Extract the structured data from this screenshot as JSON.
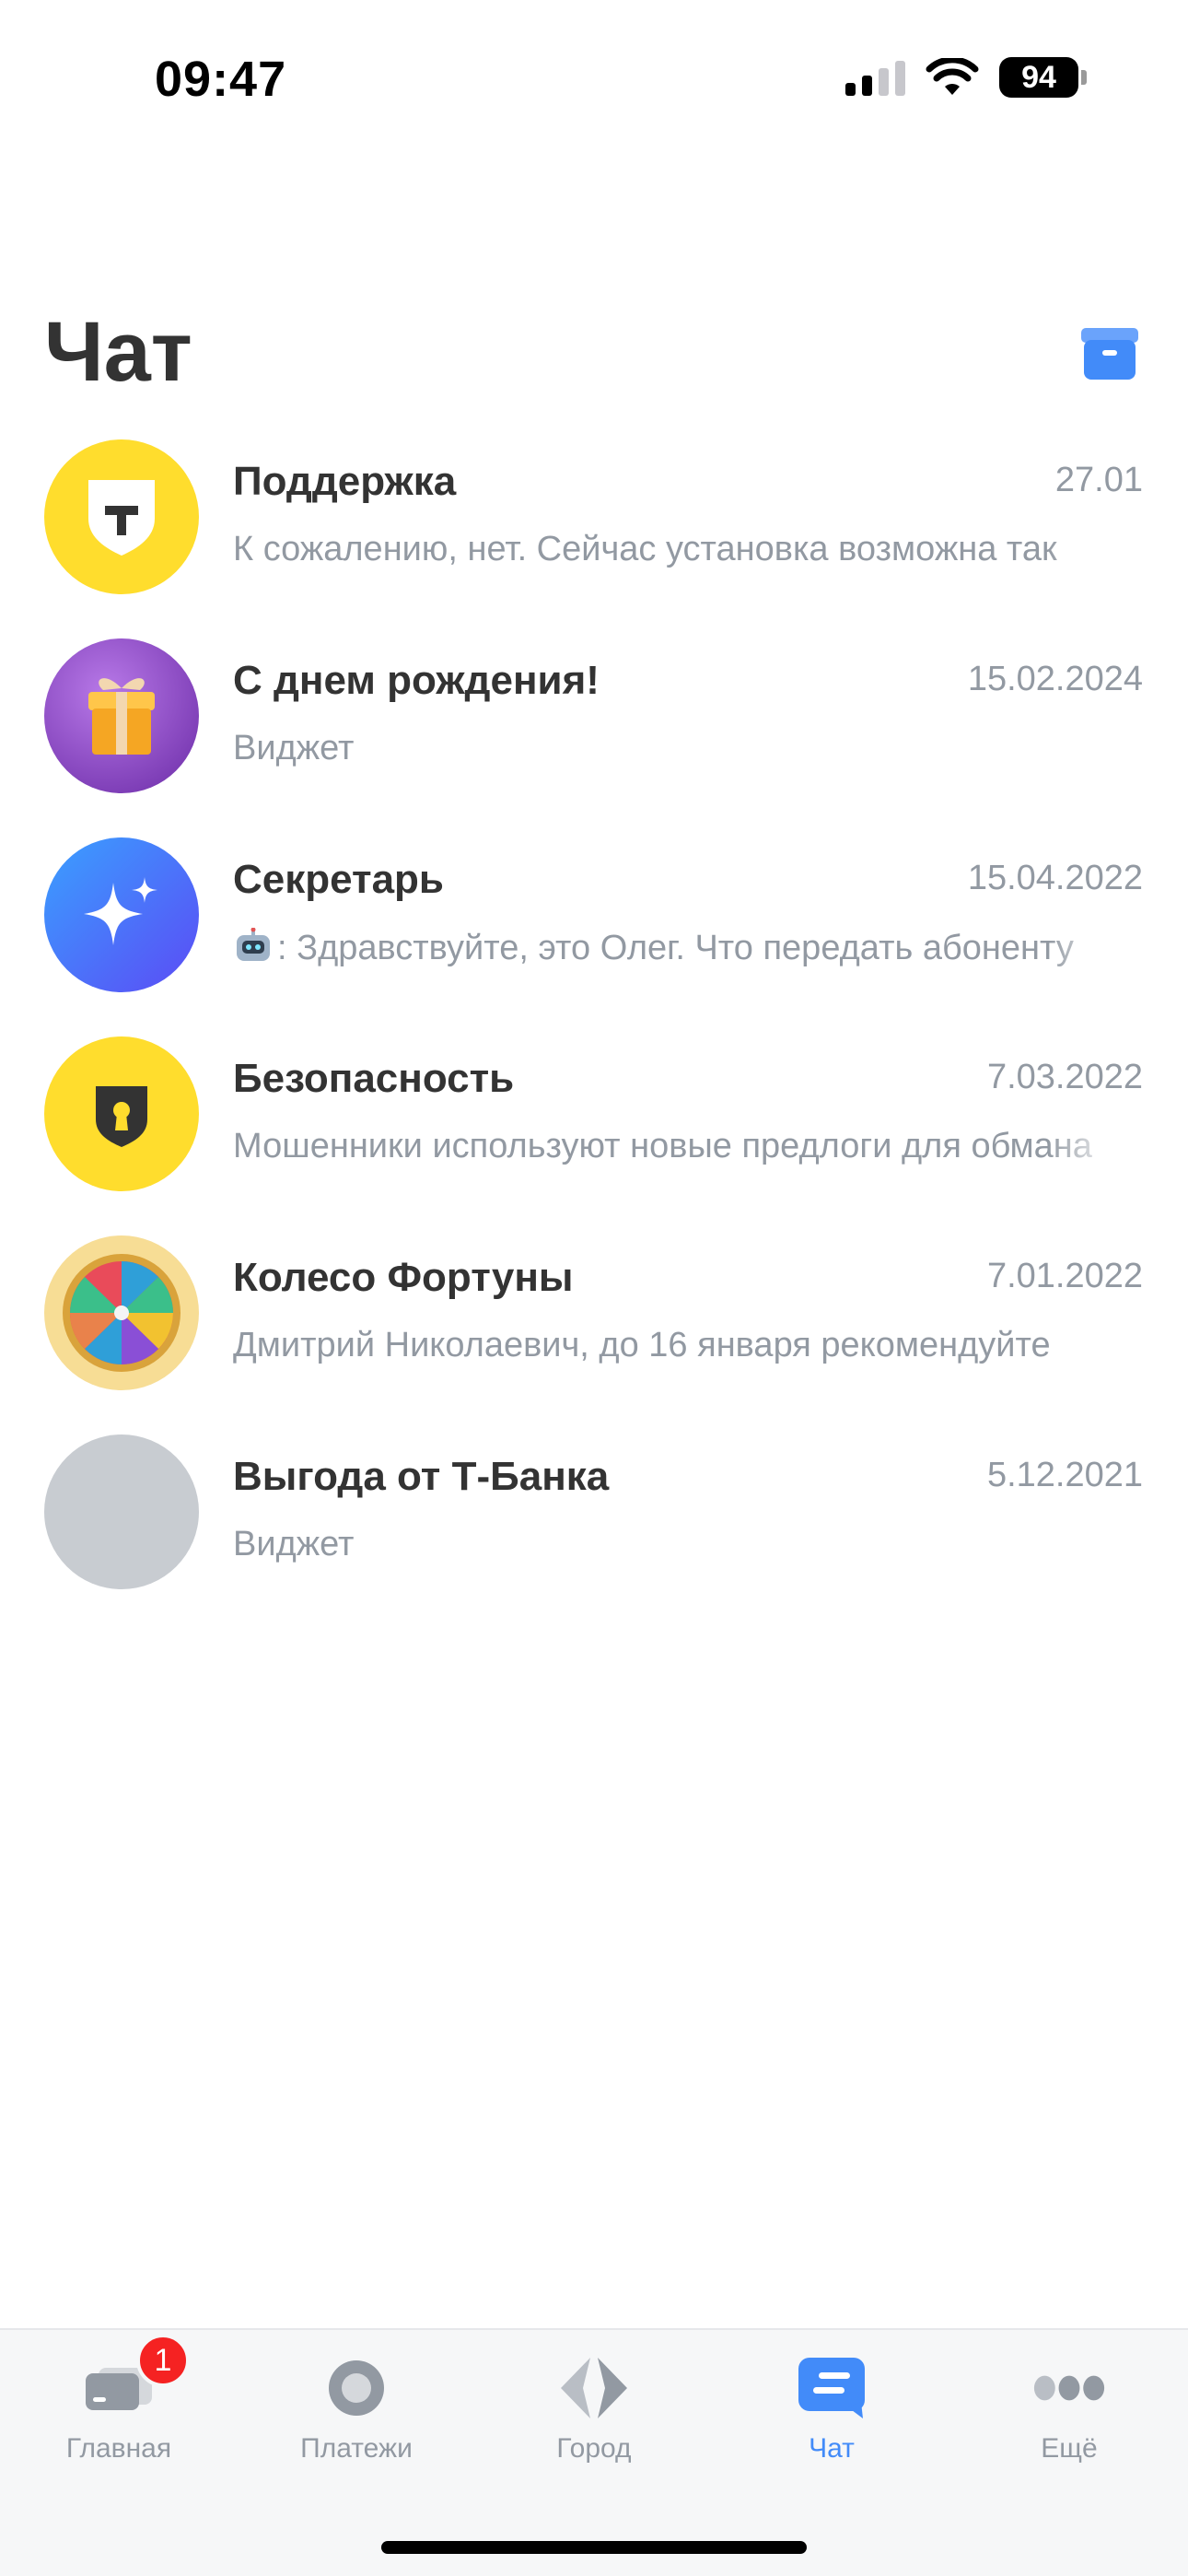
{
  "status_bar": {
    "time": "09:47",
    "battery": "94"
  },
  "header": {
    "title": "Чат"
  },
  "chats": [
    {
      "title": "Поддержка",
      "date": "27.01",
      "preview": "К сожалению, нет. Сейчас установка возможна так"
    },
    {
      "title": "С днем рождения!",
      "date": "15.02.2024",
      "preview": "Виджет"
    },
    {
      "title": "Секретарь",
      "date": "15.04.2022",
      "preview": ": Здравствуйте, это Олег. Что передать абоненту"
    },
    {
      "title": "Безопасность",
      "date": "7.03.2022",
      "preview": "Мошенники используют новые предлоги для обмана"
    },
    {
      "title": "Колесо Фортуны",
      "date": "7.01.2022",
      "preview": "Дмитрий Николаевич, до 16 января рекомендуйте"
    },
    {
      "title": "Выгода от Т-Банка",
      "date": "5.12.2021",
      "preview": "Виджет"
    }
  ],
  "tab_bar": {
    "tabs": [
      {
        "label": "Главная",
        "icon": "card-icon",
        "badge": "1"
      },
      {
        "label": "Платежи",
        "icon": "payments-icon"
      },
      {
        "label": "Город",
        "icon": "city-icon"
      },
      {
        "label": "Чат",
        "icon": "chat-icon",
        "active": true
      },
      {
        "label": "Ещё",
        "icon": "more-icon"
      }
    ]
  },
  "colors": {
    "accent": "#428bf9",
    "brand_yellow": "#ffdd2d",
    "badge_red": "#f52222",
    "muted_text": "#9299a2"
  }
}
